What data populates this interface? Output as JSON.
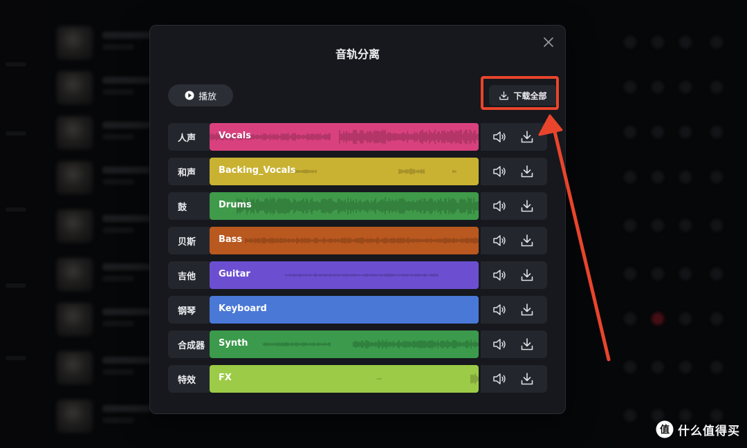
{
  "dialog": {
    "title": "音轨分离",
    "play_label": "播放",
    "download_all_label": "下载全部"
  },
  "tracks": [
    {
      "label": "人声",
      "name": "Vocals",
      "color": "#d9417e"
    },
    {
      "label": "和声",
      "name": "Backing_Vocals",
      "color": "#c9b232"
    },
    {
      "label": "鼓",
      "name": "Drums",
      "color": "#3f9a4a"
    },
    {
      "label": "贝斯",
      "name": "Bass",
      "color": "#b9581f"
    },
    {
      "label": "吉他",
      "name": "Guitar",
      "color": "#6c4fd1"
    },
    {
      "label": "钢琴",
      "name": "Keyboard",
      "color": "#4a78d6"
    },
    {
      "label": "合成器",
      "name": "Synth",
      "color": "#3b9a4b"
    },
    {
      "label": "特效",
      "name": "FX",
      "color": "#9ccb47"
    }
  ],
  "icons": {
    "close": "close-icon",
    "play": "play-icon",
    "download": "download-icon",
    "volume": "volume-icon"
  },
  "annotation": {
    "highlight_color": "#e8452c"
  },
  "watermark": {
    "logo_text": "值",
    "text": "什么值得买"
  }
}
